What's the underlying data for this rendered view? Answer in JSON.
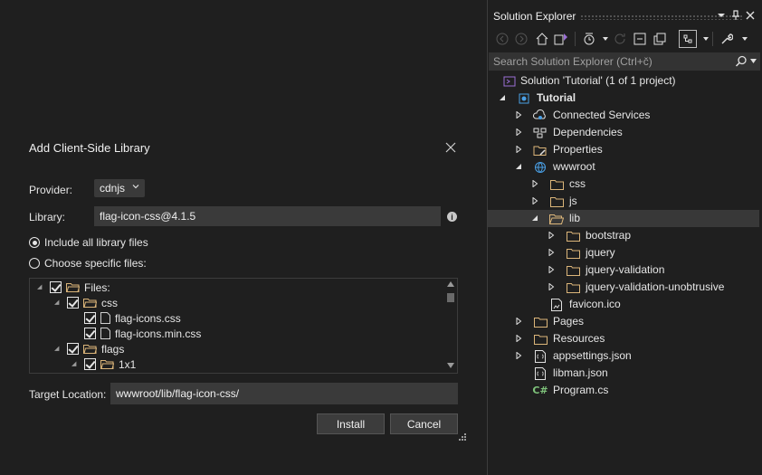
{
  "dialog": {
    "title": "Add Client-Side Library",
    "provider_label": "Provider:",
    "provider_value": "cdnjs",
    "library_label": "Library:",
    "library_value": "flag-icon-css@4.1.5",
    "radio_all": "Include all library files",
    "radio_specific": "Choose specific files:",
    "selected_radio": "all",
    "file_tree": [
      {
        "label": "Files:",
        "type": "folder",
        "checked": true
      },
      {
        "label": "css",
        "type": "folder",
        "checked": true
      },
      {
        "label": "flag-icons.css",
        "type": "file",
        "checked": true
      },
      {
        "label": "flag-icons.min.css",
        "type": "file",
        "checked": true
      },
      {
        "label": "flags",
        "type": "folder",
        "checked": true
      },
      {
        "label": "1x1",
        "type": "folder",
        "checked": true
      }
    ],
    "target_label": "Target Location:",
    "target_value": "wwwroot/lib/flag-icon-css/",
    "install_label": "Install",
    "cancel_label": "Cancel"
  },
  "solution_explorer": {
    "title": "Solution Explorer",
    "search_placeholder": "Search Solution Explorer (Ctrl+č)",
    "nodes": [
      {
        "label": "Solution 'Tutorial' (1 of 1 project)",
        "icon": "solution-icon"
      },
      {
        "label": "Tutorial",
        "icon": "project-icon",
        "bold": true
      },
      {
        "label": "Connected Services",
        "icon": "connected-services-icon"
      },
      {
        "label": "Dependencies",
        "icon": "dependencies-icon"
      },
      {
        "label": "Properties",
        "icon": "properties-icon"
      },
      {
        "label": "wwwroot",
        "icon": "globe-icon"
      },
      {
        "label": "css",
        "icon": "folder-icon"
      },
      {
        "label": "js",
        "icon": "folder-icon"
      },
      {
        "label": "lib",
        "icon": "folder-open-icon",
        "selected": true
      },
      {
        "label": "bootstrap",
        "icon": "folder-icon"
      },
      {
        "label": "jquery",
        "icon": "folder-icon"
      },
      {
        "label": "jquery-validation",
        "icon": "folder-icon"
      },
      {
        "label": "jquery-validation-unobtrusive",
        "icon": "folder-icon"
      },
      {
        "label": "favicon.ico",
        "icon": "image-file-icon"
      },
      {
        "label": "Pages",
        "icon": "folder-icon"
      },
      {
        "label": "Resources",
        "icon": "folder-icon"
      },
      {
        "label": "appsettings.json",
        "icon": "json-icon"
      },
      {
        "label": "libman.json",
        "icon": "json-icon"
      },
      {
        "label": "Program.cs",
        "icon": "csharp-icon"
      }
    ]
  },
  "colors": {
    "background": "#1f1f1f",
    "input_bg": "#3a3a3a",
    "selection_bg": "#383838",
    "folder_yellow": "#dcb67a",
    "csharp_green": "#7ec27a",
    "accent_blue": "#4aa0e6"
  }
}
